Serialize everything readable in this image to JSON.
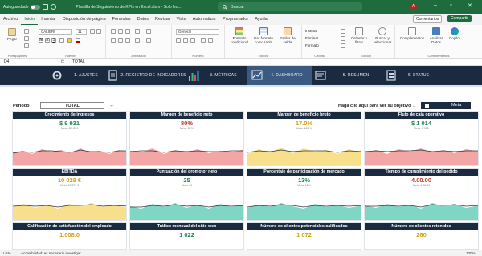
{
  "titlebar": {
    "autosave": "Autoguardado",
    "document_title": "Plantilla de Seguimiento de KPIs en Excel.xlsm - Solo lec...",
    "search_placeholder": "Buscar",
    "avatar_initial": "A"
  },
  "menu": [
    "Archivo",
    "Inicio",
    "Insertar",
    "Disposición de página",
    "Fórmulas",
    "Datos",
    "Revisar",
    "Vista",
    "Automatizar",
    "Programador",
    "Ayuda"
  ],
  "menu_buttons": {
    "comments": "Comentarios",
    "share": "Compartir"
  },
  "ribbon": {
    "paste": "Pegar",
    "font_name": "CALIBRI",
    "font_size": "11",
    "number_format": "General",
    "groups": [
      "Portapapeles",
      "Fuente",
      "Alineación",
      "Número",
      "Estilos",
      "Celdas",
      "Edición",
      "Complementos"
    ],
    "styles_items": [
      "Formato condicional",
      "Dar formato como tabla",
      "Estilos de celda"
    ],
    "cells_items": [
      "Insertar",
      "Eliminar",
      "Formato"
    ],
    "edit_items": [
      "Ordenar y filtrar",
      "Buscar y seleccionar"
    ],
    "addins_items": [
      "Complementos",
      "Analizar Datos",
      "Copilot"
    ]
  },
  "formula_bar": {
    "cell": "D4",
    "fx": "fx",
    "value": "TOTAL"
  },
  "nav": [
    {
      "label": "1. AJUSTES"
    },
    {
      "label": "2. REGISTRO DE INDICADORES"
    },
    {
      "label": "3. MÉTRICAS"
    },
    {
      "label": "4. DASHBOARD"
    },
    {
      "label": "5. RESUMEN"
    },
    {
      "label": "6. STATUS"
    }
  ],
  "controls": {
    "period_label": "Período",
    "period_value": "TOTAL",
    "link_text": "Haga clic aquí para ver su objetivo",
    "meta_label": "Meta"
  },
  "cards": [
    {
      "title": "Crecimiento de ingresos",
      "value": "$ 9 931",
      "sub": "Meta: $ 9 899",
      "color": "#1f8a4c"
    },
    {
      "title": "Margen de beneficio neto",
      "value": "80%",
      "sub": "Meta: 82%",
      "color": "#c0392b"
    },
    {
      "title": "Margen de beneficio bruto",
      "value": "17.0%",
      "sub": "Meta: 18.8%",
      "color": "#d4a017"
    },
    {
      "title": "Flujo de caja operativo",
      "value": "$ 1 014",
      "sub": "Meta: $ 955",
      "color": "#1f8a4c"
    },
    {
      "title": "EBITDA",
      "value": "10 028 €",
      "sub": "Meta: 10 577 €",
      "color": "#d4a017"
    },
    {
      "title": "Puntuación del promotor neto",
      "value": "25",
      "sub": "Meta: 24",
      "color": "#1f8a4c"
    },
    {
      "title": "Porcentaje de participación de mercado",
      "value": "13%",
      "sub": "Meta: 12%",
      "color": "#1f8a4c"
    },
    {
      "title": "Tiempo de cumplimiento del pedido",
      "value": "4.00.00",
      "sub": "Meta: 4.03.00",
      "color": "#c0392b"
    },
    {
      "title": "Calificación de satisfacción del empleado",
      "value": "1.008.0",
      "sub": "",
      "color": "#d4a017"
    },
    {
      "title": "Tráfico mensual del sitio web",
      "value": "1 022",
      "sub": "",
      "color": "#1f8a4c"
    },
    {
      "title": "Número de clientes potenciales calificados",
      "value": "1 072",
      "sub": "",
      "color": "#d4a017"
    },
    {
      "title": "Número de clientes retenidos",
      "value": "260",
      "sub": "",
      "color": "#d4a017"
    }
  ],
  "statusbar": {
    "mode": "Listo",
    "accessibility": "Accesibilidad: es necesario investigar",
    "zoom": "100%"
  }
}
